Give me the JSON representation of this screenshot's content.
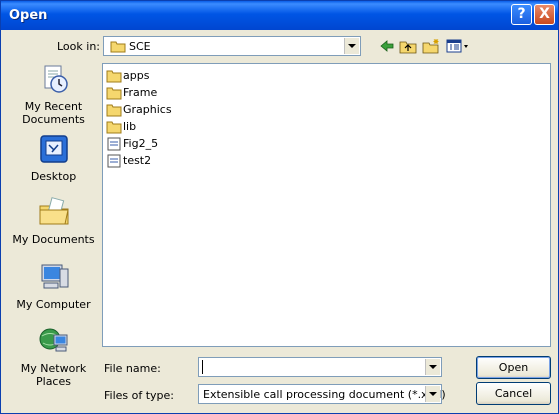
{
  "window": {
    "title": "Open",
    "help_glyph": "?",
    "close_glyph": "X"
  },
  "lookin": {
    "label": "Look in:",
    "value": "SCE",
    "toolbar_icons": [
      "back-arrow-icon",
      "up-folder-icon",
      "new-folder-icon",
      "view-menu-icon"
    ]
  },
  "places": [
    {
      "label": "My Recent Documents",
      "icon": "recent-documents-icon"
    },
    {
      "label": "Desktop",
      "icon": "desktop-icon"
    },
    {
      "label": "My Documents",
      "icon": "my-documents-icon"
    },
    {
      "label": "My Computer",
      "icon": "my-computer-icon"
    },
    {
      "label": "My Network Places",
      "icon": "network-places-icon"
    }
  ],
  "files": [
    {
      "name": "apps",
      "type": "folder"
    },
    {
      "name": "Frame",
      "type": "folder"
    },
    {
      "name": "Graphics",
      "type": "folder"
    },
    {
      "name": "lib",
      "type": "folder"
    },
    {
      "name": "Fig2_5",
      "type": "document"
    },
    {
      "name": "test2",
      "type": "document"
    }
  ],
  "filename": {
    "label": "File name:",
    "value": ""
  },
  "filetype": {
    "label": "Files of type:",
    "value": "Extensible call processing document (*.xml)"
  },
  "buttons": {
    "open": "Open",
    "cancel": "Cancel"
  },
  "colors": {
    "titlebar": "#0055e5",
    "dialog_bg": "#ece9d8",
    "folder": "#f5d76e",
    "border": "#7f9db9"
  }
}
